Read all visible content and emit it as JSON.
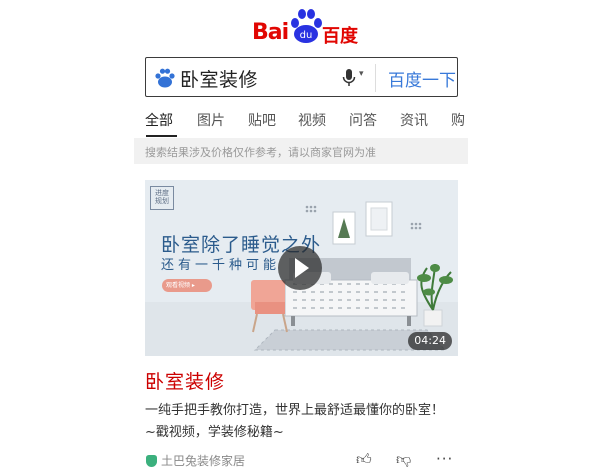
{
  "logo": {
    "bai": "Bai",
    "du": "du",
    "cn": "百度"
  },
  "search": {
    "query": "卧室装修",
    "button_label": "百度一下"
  },
  "tabs": [
    "全部",
    "图片",
    "贴吧",
    "视频",
    "问答",
    "资讯",
    "购"
  ],
  "notice": "搜索结果涉及价格仅作参考，请以商家官网为准",
  "result": {
    "thumbnail": {
      "brand": "进度\n规划",
      "headline": "卧室除了睡觉之外",
      "subline": "还有一千种可能",
      "pill": "观看视频 ▸",
      "duration": "04:24"
    },
    "title": "卧室装修",
    "description": "一纯手把手教你打造，世界上最舒适最懂你的卧室！~戳视频，学装修秘籍~",
    "source": "土巴兔装修家居"
  },
  "icons": {
    "paw": "baidu-paw-icon",
    "bear": "baidu-bear-icon",
    "mic": "microphone-icon",
    "shield": "verified-shield-icon",
    "like": "thumbs-up-icon",
    "dislike": "thumbs-down-icon",
    "more": "more-dots-icon"
  },
  "colors": {
    "brand_red": "#e10602",
    "link_blue": "#3879d9",
    "title_red": "#cc0000"
  }
}
